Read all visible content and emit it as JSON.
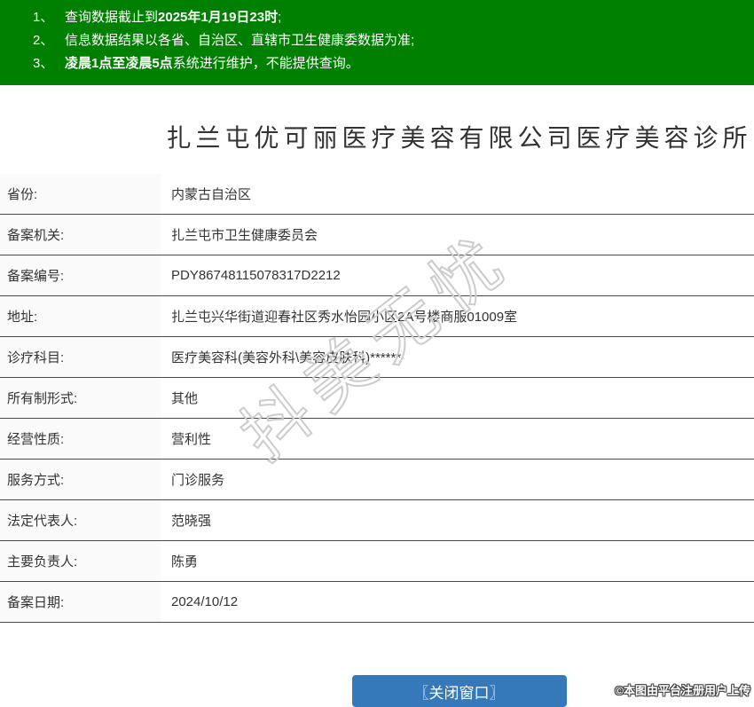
{
  "notice": {
    "lines": [
      {
        "num": "1、",
        "parts": [
          {
            "t": "查询数据截止到",
            "b": false
          },
          {
            "t": "2025年1月19日23时",
            "b": true
          },
          {
            "t": ";",
            "b": false
          }
        ]
      },
      {
        "num": "2、",
        "parts": [
          {
            "t": "信息数据结果以各省、自治区、直辖市卫生健康委数据为准;",
            "b": false
          }
        ]
      },
      {
        "num": "3、",
        "parts": [
          {
            "t": "凌晨1点至凌晨5点",
            "b": true
          },
          {
            "t": "系统进行维护，不能提供查询。",
            "b": false
          }
        ]
      }
    ]
  },
  "title": "扎兰屯优可丽医疗美容有限公司医疗美容诊所",
  "record": {
    "rows": [
      {
        "label": "省份:",
        "value": "内蒙古自治区"
      },
      {
        "label": "备案机关:",
        "value": "扎兰屯市卫生健康委员会"
      },
      {
        "label": "备案编号:",
        "value": "PDY86748115078317D2212"
      },
      {
        "label": "地址:",
        "value": "扎兰屯兴华街道迎春社区秀水怡园小区2A号楼商服01009室"
      },
      {
        "label": "诊疗科目:",
        "value": "医疗美容科(美容外科\\美容皮肤科)******"
      },
      {
        "label": "所有制形式:",
        "value": "其他"
      },
      {
        "label": "经营性质:",
        "value": "营利性"
      },
      {
        "label": "服务方式:",
        "value": "门诊服务"
      },
      {
        "label": "法定代表人:",
        "value": "范晓强"
      },
      {
        "label": "主要负责人:",
        "value": "陈勇"
      },
      {
        "label": "备案日期:",
        "value": "2024/10/12"
      }
    ]
  },
  "close_button_label": "〖关闭窗口〗",
  "watermark": "抖美无忧",
  "copyright": "©本图由平台注册用户上传",
  "colors": {
    "header_bg": "#008000",
    "divider": "#00703c",
    "button_bg": "#3579bb",
    "label_bg": "#fafafa"
  }
}
